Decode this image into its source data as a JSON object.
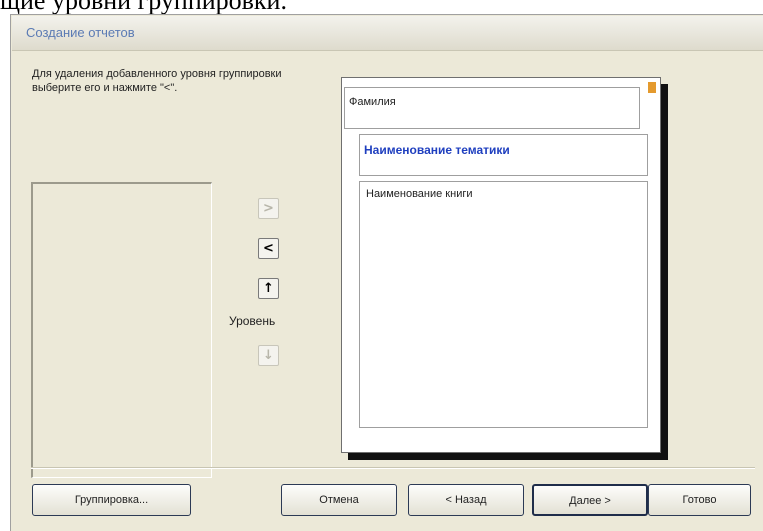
{
  "document_caption": "щие уровни группировки.",
  "window": {
    "title": "Создание отчетов"
  },
  "instructions": "Для удаления добавленного уровня группировки выберите его и нажмите \"<\".",
  "controls": {
    "add_button": ">",
    "remove_button": "<",
    "up_button": "↑",
    "down_button": "↓",
    "level_label": "Уровень"
  },
  "preview": {
    "group_level_1": "Фамилия",
    "group_level_2": "Наименование тематики",
    "detail_field": "Наименование книги"
  },
  "buttons": {
    "grouping": "Группировка...",
    "cancel": "Отмена",
    "back": "< Назад",
    "next": "Далее >",
    "finish": "Готово"
  }
}
